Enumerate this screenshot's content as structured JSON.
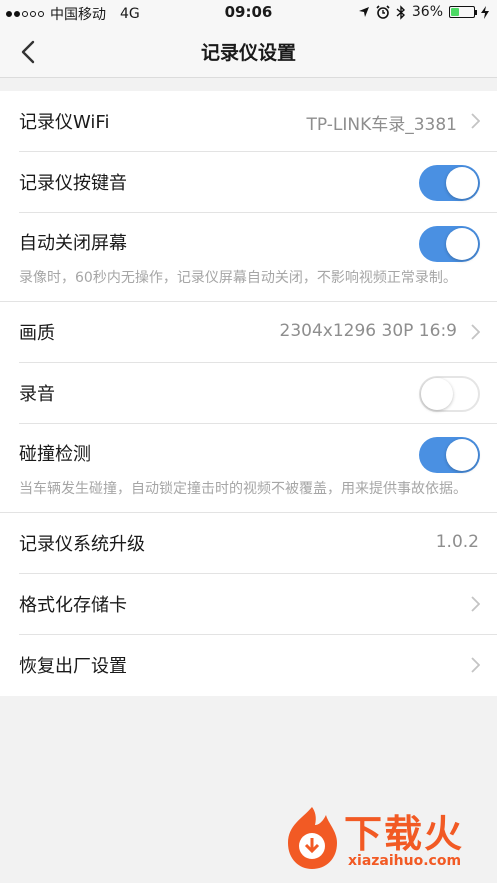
{
  "status_bar": {
    "carrier": "中国移动",
    "network": "4G",
    "time": "09:06",
    "battery": "36%",
    "battery_level": 0.36
  },
  "nav": {
    "title": "记录仪设置"
  },
  "settings": {
    "wifi": {
      "label": "记录仪WiFi",
      "value": "TP-LINK车录_3381"
    },
    "key_sound": {
      "label": "记录仪按键音",
      "state": "on"
    },
    "auto_screen_off": {
      "label": "自动关闭屏幕",
      "state": "on",
      "note": "录像时，60秒内无操作，记录仪屏幕自动关闭，不影响视频正常录制。"
    },
    "quality": {
      "label": "画质",
      "value": "2304x1296 30P 16:9"
    },
    "audio": {
      "label": "录音",
      "state": "off"
    },
    "collision": {
      "label": "碰撞检测",
      "state": "on",
      "note": "当车辆发生碰撞，自动锁定撞击时的视频不被覆盖，用来提供事故依据。"
    },
    "upgrade": {
      "label": "记录仪系统升级",
      "value": "1.0.2"
    },
    "format_card": {
      "label": "格式化存储卡"
    },
    "factory_reset": {
      "label": "恢复出厂设置"
    }
  },
  "watermark": {
    "brand": "下载火",
    "url": "xiazaihuo.com"
  },
  "colors": {
    "switch_on": "#4a90e2",
    "watermark": "#f25a24"
  }
}
